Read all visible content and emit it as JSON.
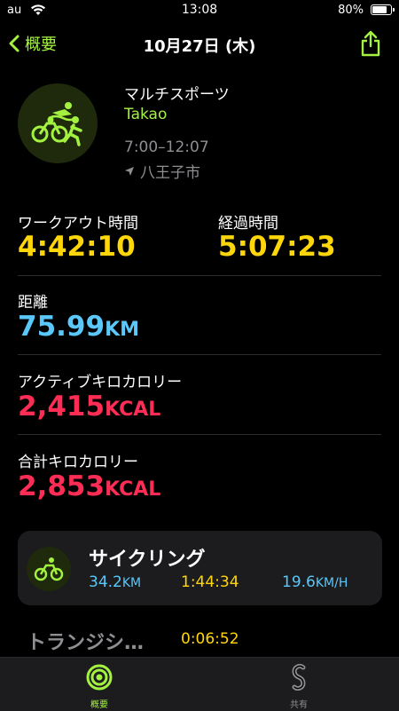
{
  "status_bar": {
    "carrier": "au",
    "time": "13:08",
    "battery_pct": "80%",
    "battery_level": 0.8
  },
  "nav": {
    "back_label": "概要",
    "title": "10月27日 (木)"
  },
  "workout": {
    "type": "マルチスポーツ",
    "location": "Takao",
    "time_range": "7:00–12:07",
    "city": "八王子市"
  },
  "metrics": {
    "workout_time": {
      "label": "ワークアウト時間",
      "value": "4:42:10"
    },
    "elapsed_time": {
      "label": "経過時間",
      "value": "5:07:23"
    },
    "distance": {
      "label": "距離",
      "value": "75.99",
      "unit": "KM"
    },
    "active_kcal": {
      "label": "アクティブキロカロリー",
      "value": "2,415",
      "unit": "KCAL"
    },
    "total_kcal": {
      "label": "合計キロカロリー",
      "value": "2,853",
      "unit": "KCAL"
    }
  },
  "segments": {
    "cycling": {
      "title": "サイクリング",
      "distance": "34.2",
      "distance_unit": "KM",
      "duration": "1:44:34",
      "speed": "19.6",
      "speed_unit": "KM/H"
    },
    "transition": {
      "title": "トランジシ…",
      "duration": "0:06:52"
    }
  },
  "tabbar": {
    "summary_label": "概要",
    "sharing_label": "共有"
  },
  "colors": {
    "accent": "#a3f240",
    "yellow": "#ffd60a",
    "blue": "#5ac8fa",
    "red": "#ff2d55",
    "gray": "#8e8e93"
  }
}
